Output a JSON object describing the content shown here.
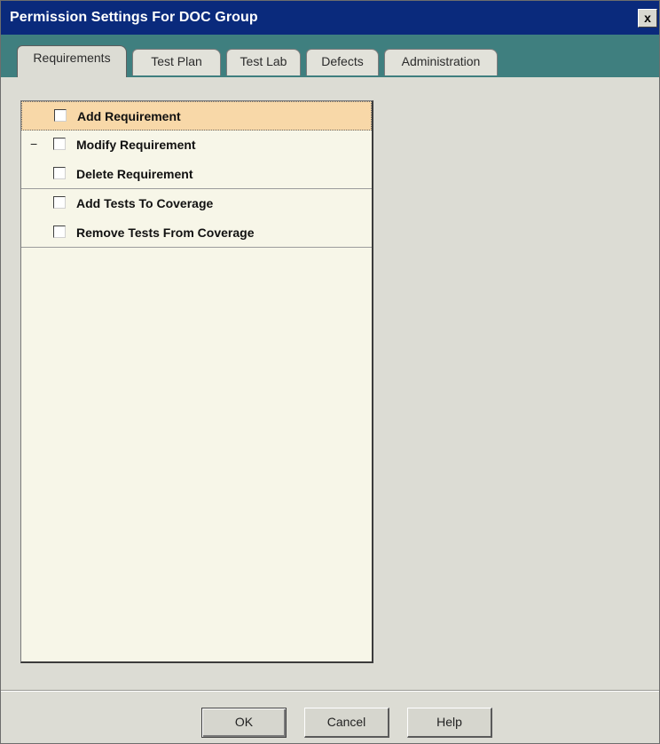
{
  "window": {
    "title": "Permission Settings For DOC Group",
    "close_label": "x"
  },
  "tabs": [
    {
      "label": "Requirements",
      "active": true
    },
    {
      "label": "Test Plan",
      "active": false
    },
    {
      "label": "Test Lab",
      "active": false
    },
    {
      "label": "Defects",
      "active": false
    },
    {
      "label": "Administration",
      "active": false
    }
  ],
  "permissions": [
    {
      "label": "Add Requirement",
      "checked": false,
      "expander": "",
      "highlighted": true
    },
    {
      "label": "Modify Requirement",
      "checked": false,
      "expander": "−",
      "highlighted": false
    },
    {
      "label": "Delete Requirement",
      "checked": false,
      "expander": "",
      "highlighted": false
    },
    {
      "label": "Add Tests To Coverage",
      "checked": false,
      "expander": "",
      "highlighted": false
    },
    {
      "label": "Remove Tests From Coverage",
      "checked": false,
      "expander": "",
      "highlighted": false
    }
  ],
  "buttons": {
    "ok": "OK",
    "cancel": "Cancel",
    "help": "Help"
  },
  "colors": {
    "titlebar": "#0a2a7c",
    "tabstrip": "#3f7f7f",
    "highlight": "#f8d8a8",
    "list_bg": "#f7f6e8"
  }
}
